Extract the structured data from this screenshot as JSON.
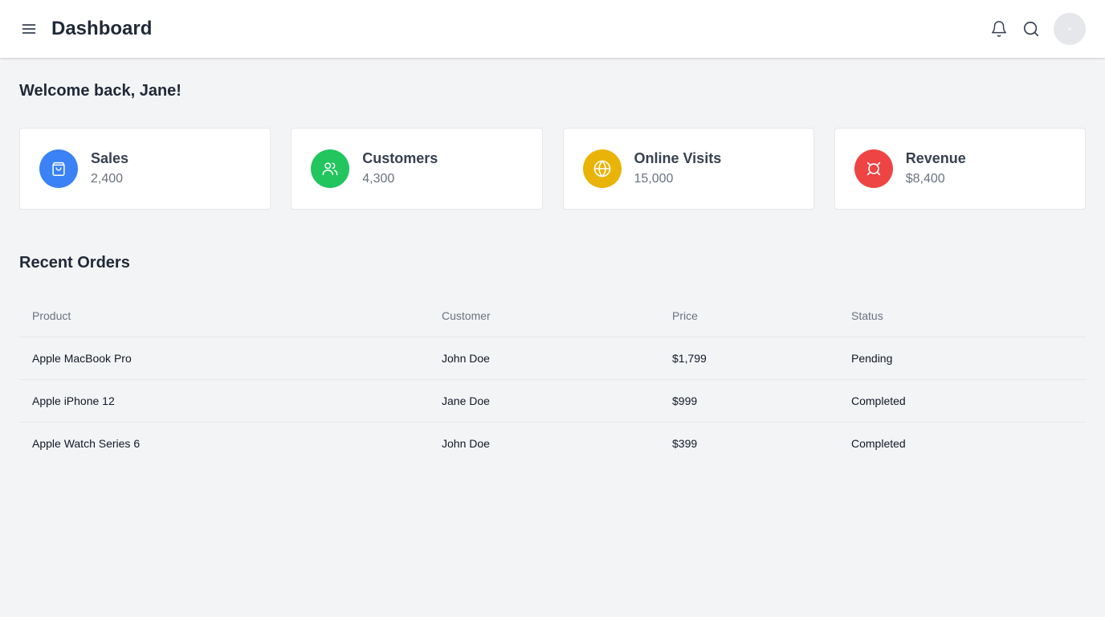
{
  "header": {
    "title": "Dashboard",
    "icons": [
      "menu-icon",
      "bell-icon",
      "search-icon",
      "avatar"
    ]
  },
  "welcome": "Welcome back, Jane!",
  "stats": [
    {
      "label": "Sales",
      "value": "2,400",
      "icon": "shopping-bag-icon",
      "color": "#3b82f6"
    },
    {
      "label": "Customers",
      "value": "4,300",
      "icon": "users-icon",
      "color": "#22c55e"
    },
    {
      "label": "Online Visits",
      "value": "15,000",
      "icon": "globe-icon",
      "color": "#eab308"
    },
    {
      "label": "Revenue",
      "value": "$8,400",
      "icon": "currency-icon",
      "color": "#ef4444"
    }
  ],
  "orders": {
    "title": "Recent Orders",
    "columns": [
      "Product",
      "Customer",
      "Price",
      "Status"
    ],
    "rows": [
      [
        "Apple MacBook Pro",
        "John Doe",
        "$1,799",
        "Pending"
      ],
      [
        "Apple iPhone 12",
        "Jane Doe",
        "$999",
        "Completed"
      ],
      [
        "Apple Watch Series 6",
        "John Doe",
        "$399",
        "Completed"
      ]
    ]
  }
}
